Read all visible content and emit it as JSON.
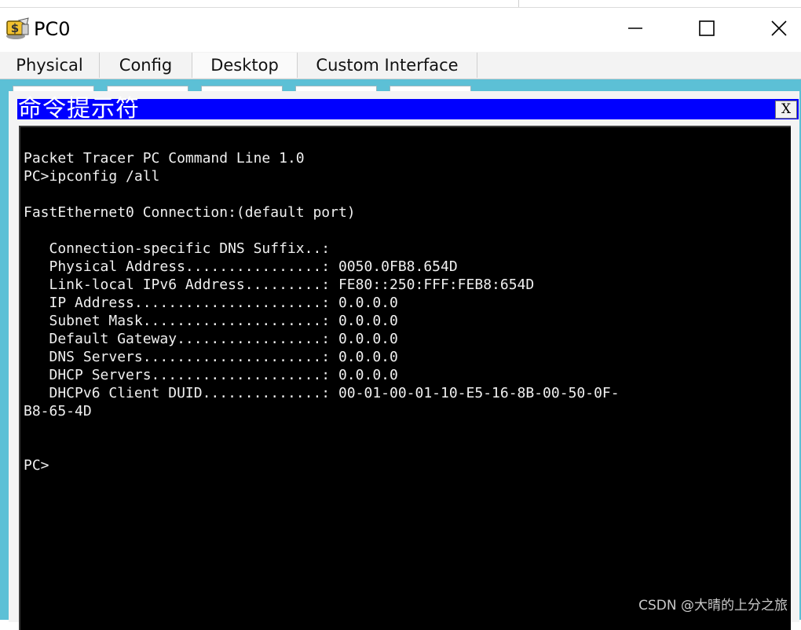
{
  "window": {
    "title": "PC0",
    "app_icon": "packet-tracer-pc-icon",
    "controls": {
      "minimize_icon": "minimize-icon",
      "maximize_icon": "maximize-icon",
      "close_icon": "close-icon"
    }
  },
  "tabs": [
    {
      "label": "Physical",
      "active": false
    },
    {
      "label": "Config",
      "active": false
    },
    {
      "label": "Desktop",
      "active": true
    },
    {
      "label": "Custom Interface",
      "active": false
    }
  ],
  "command_prompt": {
    "title": "命令提示符",
    "close_label": "X",
    "lines": [
      "Packet Tracer PC Command Line 1.0",
      "PC>ipconfig /all",
      "",
      "FastEthernet0 Connection:(default port)",
      "",
      "   Connection-specific DNS Suffix..:",
      "   Physical Address................: 0050.0FB8.654D",
      "   Link-local IPv6 Address.........: FE80::250:FFF:FEB8:654D",
      "   IP Address......................: 0.0.0.0",
      "   Subnet Mask.....................: 0.0.0.0",
      "   Default Gateway.................: 0.0.0.0",
      "   DNS Servers.....................: 0.0.0.0",
      "   DHCP Servers....................: 0.0.0.0",
      "   DHCPv6 Client DUID..............: 00-01-00-01-10-E5-16-8B-00-50-0F-",
      "B8-65-4D",
      "",
      "",
      "PC>"
    ]
  },
  "watermark": "CSDN @大晴的上分之旅",
  "colors": {
    "desktop_bg": "#5cc0d6",
    "cmd_titlebar": "#0000ff",
    "terminal_bg": "#000000",
    "terminal_fg": "#f0f0f0"
  }
}
